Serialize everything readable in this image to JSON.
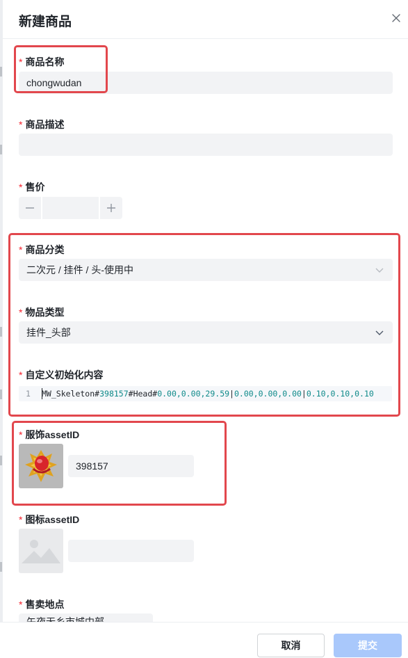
{
  "dialog": {
    "title": "新建商品",
    "close_icon": "close-icon"
  },
  "form": {
    "required_mark": "*",
    "name": {
      "label": "商品名称",
      "value": "chongwudan"
    },
    "description": {
      "label": "商品描述",
      "value": ""
    },
    "price": {
      "label": "售价",
      "value": "",
      "decrement_icon": "minus-icon",
      "increment_icon": "plus-icon"
    },
    "category": {
      "label": "商品分类",
      "value": "二次元 / 挂件 / 头-使用中"
    },
    "item_type": {
      "label": "物品类型",
      "value": "挂件_头部"
    },
    "custom_init": {
      "label": "自定义初始化内容",
      "line_number": "1",
      "segments": [
        {
          "text": "MW_Skeleton#",
          "kind": "plain"
        },
        {
          "text": "398157",
          "kind": "num"
        },
        {
          "text": "#Head#",
          "kind": "plain"
        },
        {
          "text": "0.00,0.00,29.59",
          "kind": "num"
        },
        {
          "text": "|",
          "kind": "plain"
        },
        {
          "text": "0.00,0.00,0.00",
          "kind": "num"
        },
        {
          "text": "|",
          "kind": "plain"
        },
        {
          "text": "0.10,0.10,0.10",
          "kind": "num"
        }
      ]
    },
    "outfit_asset": {
      "label": "服饰assetID",
      "value": "398157"
    },
    "icon_asset": {
      "label": "图标assetID",
      "value": ""
    },
    "sale_location": {
      "label": "售卖地点",
      "value": "午夜无乡市城中部"
    }
  },
  "footer": {
    "cancel_label": "取消",
    "submit_label": "提交"
  },
  "colors": {
    "highlight": "#e2474d",
    "required": "#f5222d",
    "submit_disabled": "#a9c8fb",
    "field_bg": "#f2f3f5"
  }
}
